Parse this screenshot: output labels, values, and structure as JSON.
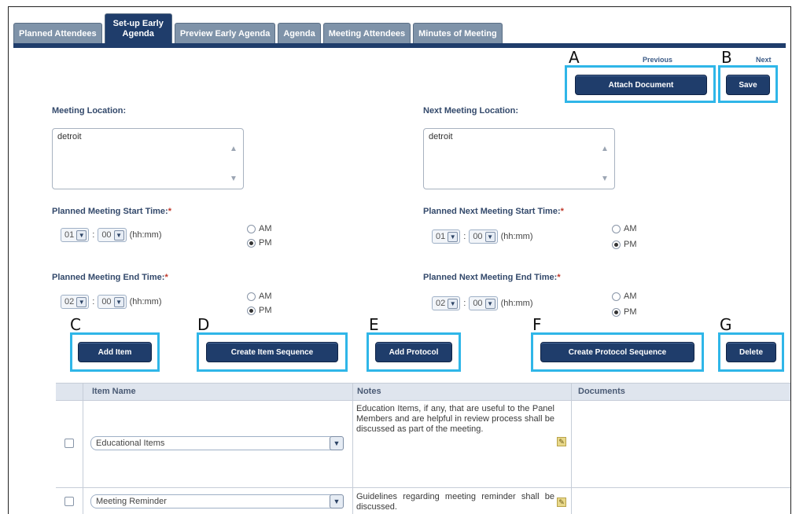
{
  "tabs": [
    {
      "label": "Planned Attendees"
    },
    {
      "label": "Set-up Early Agenda",
      "line1": "Set-up Early",
      "line2": "Agenda"
    },
    {
      "label": "Preview Early Agenda"
    },
    {
      "label": "Agenda"
    },
    {
      "label": "Meeting Attendees"
    },
    {
      "label": "Minutes of Meeting"
    }
  ],
  "nav": {
    "previous": "Previous",
    "next": "Next"
  },
  "buttons": {
    "attach_document": "Attach Document",
    "save": "Save",
    "add_item": "Add Item",
    "create_item_sequence": "Create Item Sequence",
    "add_protocol": "Add Protocol",
    "create_protocol_sequence": "Create Protocol Sequence",
    "delete": "Delete"
  },
  "callouts": {
    "a": "A",
    "b": "B",
    "c": "C",
    "d": "D",
    "e": "E",
    "f": "F",
    "g": "G"
  },
  "form": {
    "meeting_location_label": "Meeting Location:",
    "meeting_location_value": "detroit",
    "next_meeting_location_label": "Next Meeting Location:",
    "next_meeting_location_value": "detroit",
    "start_time_label": "Planned Meeting Start Time:",
    "next_start_time_label": "Planned Next Meeting Start Time:",
    "end_time_label": "Planned Meeting End Time:",
    "next_end_time_label": "Planned Next Meeting End Time:",
    "required_mark": "*",
    "start_hour": "01",
    "start_minute": "00",
    "next_start_hour": "01",
    "next_start_minute": "00",
    "end_hour": "02",
    "end_minute": "00",
    "next_end_hour": "02",
    "next_end_minute": "00",
    "colon": ":",
    "format_hint": "(hh:mm)",
    "am": "AM",
    "pm": "PM",
    "start_ampm": "PM",
    "next_start_ampm": "PM",
    "end_ampm": "PM",
    "next_end_ampm": "PM"
  },
  "table": {
    "headers": {
      "item_name": "Item Name",
      "notes": "Notes",
      "documents": "Documents"
    },
    "rows": [
      {
        "item": "Educational Items",
        "notes": "Education Items, if any, that are useful to the Panel Members and are helpful in review process shall be discussed as part of the meeting."
      },
      {
        "item": "Meeting Reminder",
        "notes": "Guidelines regarding meeting reminder shall be discussed."
      }
    ]
  }
}
